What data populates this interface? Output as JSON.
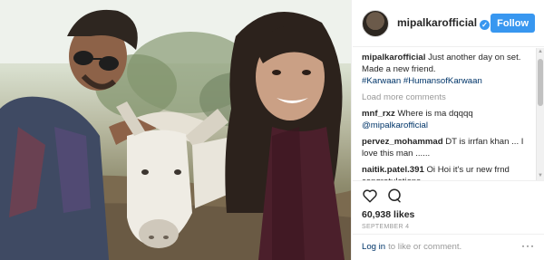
{
  "header": {
    "username": "mipalkarofficial",
    "follow_label": "Follow",
    "verified_icon": "verified-badge-icon"
  },
  "caption": {
    "username": "mipalkarofficial",
    "text": "Just another day on set. Made a new friend.",
    "hashtags": "#Karwaan #HumansofKarwaan"
  },
  "load_more": "Load more comments",
  "comments": [
    {
      "username": "mnf_rxz",
      "text": "Where is ma dqqqq",
      "mention": "@mipalkarofficial"
    },
    {
      "username": "pervez_mohammad",
      "text": "DT is irrfan khan ... I love this man ......"
    },
    {
      "username": "naitik.patel.391",
      "text": "Oi Hoi it's ur new frnd congratulations"
    }
  ],
  "actions": {
    "likes": "60,938 likes",
    "date": "SEPTEMBER 4"
  },
  "footer": {
    "login_text": "Log in",
    "rest_text": "to like or comment.",
    "more_icon": "more-options-icon"
  },
  "colors": {
    "accent": "#3897f0",
    "link": "#003569",
    "muted": "#999999"
  }
}
